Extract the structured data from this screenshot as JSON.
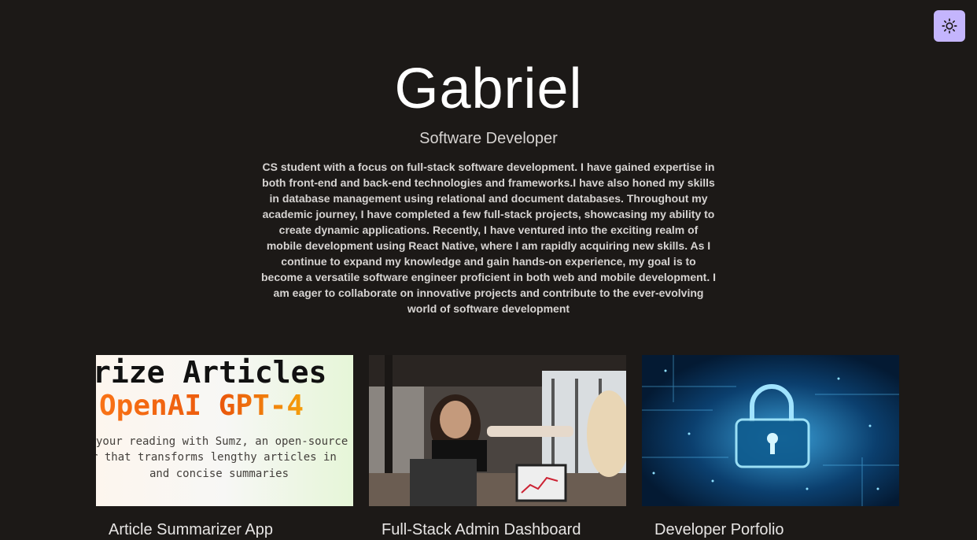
{
  "theme_toggle": {
    "icon": "sun-icon"
  },
  "hero": {
    "name": "Gabriel",
    "role": "Software Developer",
    "bio": "CS student with a focus on full-stack software development. I have gained expertise in both front-end and back-end technologies and frameworks.I have also honed my skills in database management using relational and document databases. Throughout my academic journey, I have completed a few full-stack projects, showcasing my ability to create dynamic applications. Recently, I have ventured into the exciting realm of mobile development using React Native, where I am rapidly acquiring new skills. As I continue to expand my knowledge and gain hands-on experience, my goal is to become a versatile software engineer proficient in both web and mobile development. I am eager to collaborate on innovative projects and contribute to the ever-evolving world of software development"
  },
  "projects": [
    {
      "title": "Article Summarizer App",
      "thumb_text": {
        "line1": "rize Articles",
        "line2": "OpenAI GPT-4",
        "line3": "your reading with Sumz, an open-source",
        "line4": "r that transforms lengthy articles in",
        "line5": "and concise summaries"
      }
    },
    {
      "title": "Full-Stack Admin Dashboard"
    },
    {
      "title": "Developer Porfolio"
    }
  ],
  "colors": {
    "background": "#1c1917",
    "toggle_bg": "#c4b5fd",
    "accent_orange": "#f97316"
  }
}
